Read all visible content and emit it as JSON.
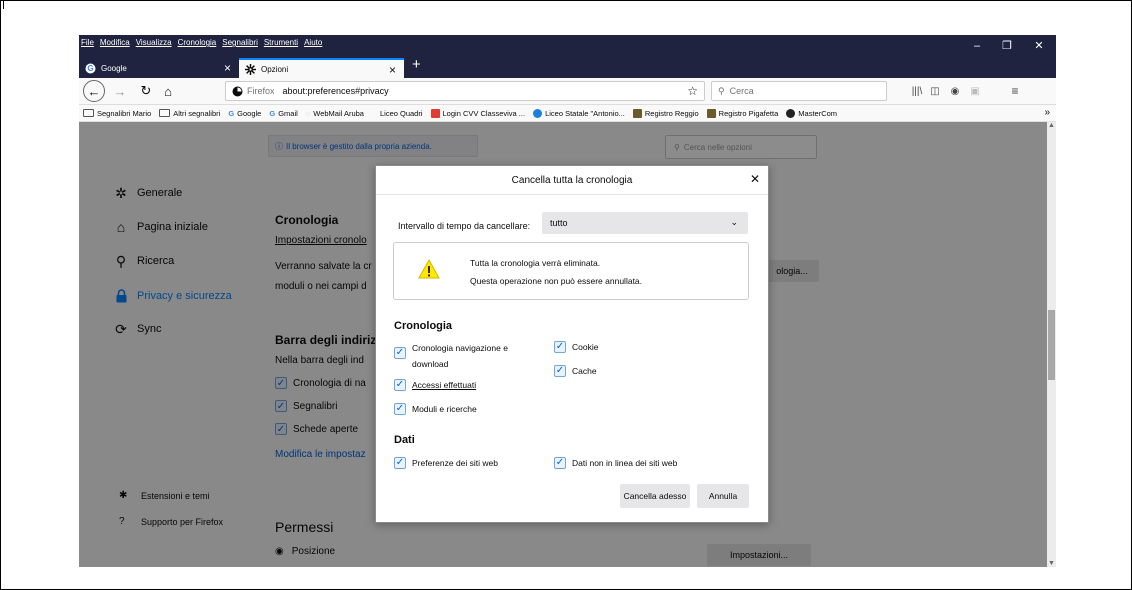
{
  "menubar": {
    "items": [
      "File",
      "Modifica",
      "Visualizza",
      "Cronologia",
      "Segnalibri",
      "Strumenti",
      "Aiuto"
    ]
  },
  "window_controls": {
    "minimize": "–",
    "restore": "❐",
    "close": "✕"
  },
  "tabs": [
    {
      "title": "Google",
      "icon": "google-icon",
      "active": false
    },
    {
      "title": "Opzioni",
      "icon": "gear-icon",
      "active": true
    }
  ],
  "navbar": {
    "identity": "Firefox",
    "url": "about:preferences#privacy",
    "search_placeholder": "Cerca"
  },
  "bookmarks": [
    {
      "label": "Segnalibri Mario",
      "icon": "folder-icon",
      "color": "#ffffff"
    },
    {
      "label": "Altri segnalibri",
      "icon": "folder-icon",
      "color": "#ffffff"
    },
    {
      "label": "Google",
      "icon": "google-icon",
      "color": "#4285f4"
    },
    {
      "label": "Gmail",
      "icon": "google-icon",
      "color": "#4285f4"
    },
    {
      "label": "WebMail Aruba",
      "icon": "webmail-icon",
      "color": "#d0d0d0"
    },
    {
      "label": "Liceo Quadri",
      "icon": "none",
      "color": ""
    },
    {
      "label": "Login CVV Classeviva ...",
      "icon": "classeviva-icon",
      "color": "#e03c31"
    },
    {
      "label": "Liceo Statale \"Antonio...",
      "icon": "liceo-icon",
      "color": "#1e7fd9"
    },
    {
      "label": "Registro Reggio",
      "icon": "registro-icon",
      "color": "#6b5a2c"
    },
    {
      "label": "Registro Pigafetta",
      "icon": "registro-icon",
      "color": "#6b5a2c"
    },
    {
      "label": "MasterCom",
      "icon": "mastercom-icon",
      "color": "#222222"
    }
  ],
  "prefs": {
    "managed_notice": "Il browser è gestito dalla propria azienda.",
    "search_placeholder": "Cerca nelle opzioni",
    "categories": [
      {
        "label": "Generale",
        "icon": "gear-icon"
      },
      {
        "label": "Pagina iniziale",
        "icon": "home-icon"
      },
      {
        "label": "Ricerca",
        "icon": "search-icon"
      },
      {
        "label": "Privacy e sicurezza",
        "icon": "lock-icon"
      },
      {
        "label": "Sync",
        "icon": "sync-icon"
      }
    ],
    "footer": [
      {
        "label": "Estensioni e temi",
        "icon": "puzzle-icon"
      },
      {
        "label": "Supporto per Firefox",
        "icon": "help-icon"
      }
    ],
    "history_title": "Cronologia",
    "history_sub": "Impostazioni cronolo",
    "history_text1": "Verranno salvate la cr",
    "history_text2": "moduli o nei campi d",
    "history_btn": "ologia...",
    "addressbar_title": "Barra degli indiriz",
    "addressbar_text": "Nella barra degli ind",
    "addressbar_checks": [
      "Cronologia di na",
      "Segnalibri",
      "Schede aperte"
    ],
    "addressbar_link": "Modifica le impostaz",
    "permissions_title": "Permessi",
    "position_label": "Posizione",
    "settings_btn": "Impostazioni..."
  },
  "dialog": {
    "title": "Cancella tutta la cronologia",
    "range_label": "Intervallo di tempo da cancellare:",
    "range_value": "tutto",
    "warning_line1": "Tutta la cronologia verrà eliminata.",
    "warning_line2": "Questa operazione non può essere annullata.",
    "history_section": "Cronologia",
    "history_items": [
      {
        "label": "Cronologia navigazione e download",
        "checked": true
      },
      {
        "label": "Accessi effettuati",
        "checked": true
      },
      {
        "label": "Moduli e ricerche",
        "checked": true
      },
      {
        "label": "Cookie",
        "checked": true
      },
      {
        "label": "Cache",
        "checked": true
      }
    ],
    "data_section": "Dati",
    "data_items": [
      {
        "label": "Preferenze dei siti web",
        "checked": true
      },
      {
        "label": "Dati non in linea dei siti web",
        "checked": true
      }
    ],
    "clear_button": "Cancella adesso",
    "cancel_button": "Annulla"
  }
}
